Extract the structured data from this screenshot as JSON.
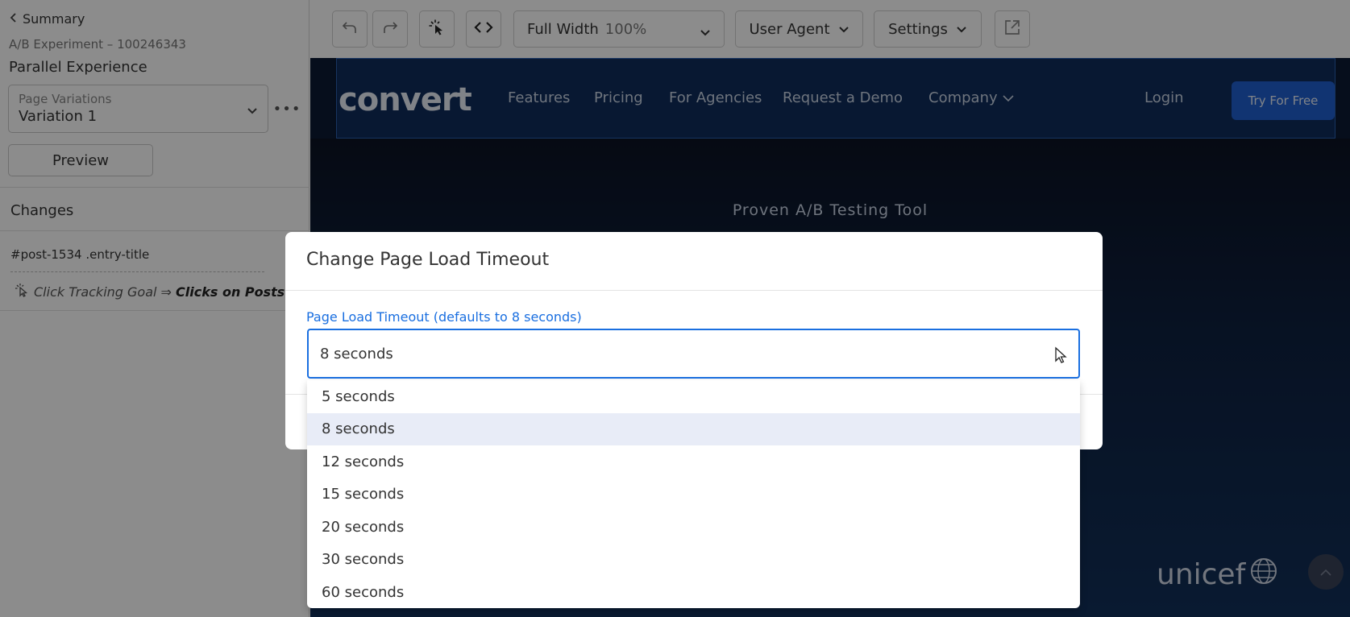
{
  "sidebar": {
    "back_label": "Summary",
    "experiment_id": "A/B Experiment – 100246343",
    "experiment_name": "Parallel Experience",
    "variation_select": {
      "label": "Page Variations",
      "value": "Variation 1"
    },
    "more_label": "•••",
    "preview_label": "Preview",
    "changes_title": "Changes",
    "change_selector": "#post-1534 .entry-title",
    "goal_prefix": "Click Tracking Goal ⇒ ",
    "goal_name": "Clicks on Posts"
  },
  "toolbar": {
    "width_label": "Full Width",
    "width_value": "100%",
    "user_agent_label": "User Agent",
    "settings_label": "Settings"
  },
  "site": {
    "logo": "convert",
    "nav": [
      "Features",
      "Pricing",
      "For Agencies",
      "Request a Demo",
      "Company"
    ],
    "login": "Login",
    "cta": "Try For Free",
    "hero_tagline": "Proven A/B Testing Tool",
    "partner_logo": "unicef"
  },
  "modal": {
    "title": "Change Page Load Timeout",
    "field_label": "Page Load Timeout (defaults to 8 seconds)",
    "selected_value": "8 seconds",
    "options": [
      "5 seconds",
      "8 seconds",
      "12 seconds",
      "15 seconds",
      "20 seconds",
      "30 seconds",
      "60 seconds"
    ],
    "selected_index": 1
  },
  "colors": {
    "accent": "#1a6fe0",
    "cta": "#1f5fd0",
    "option_highlight": "#e8ecf7"
  }
}
